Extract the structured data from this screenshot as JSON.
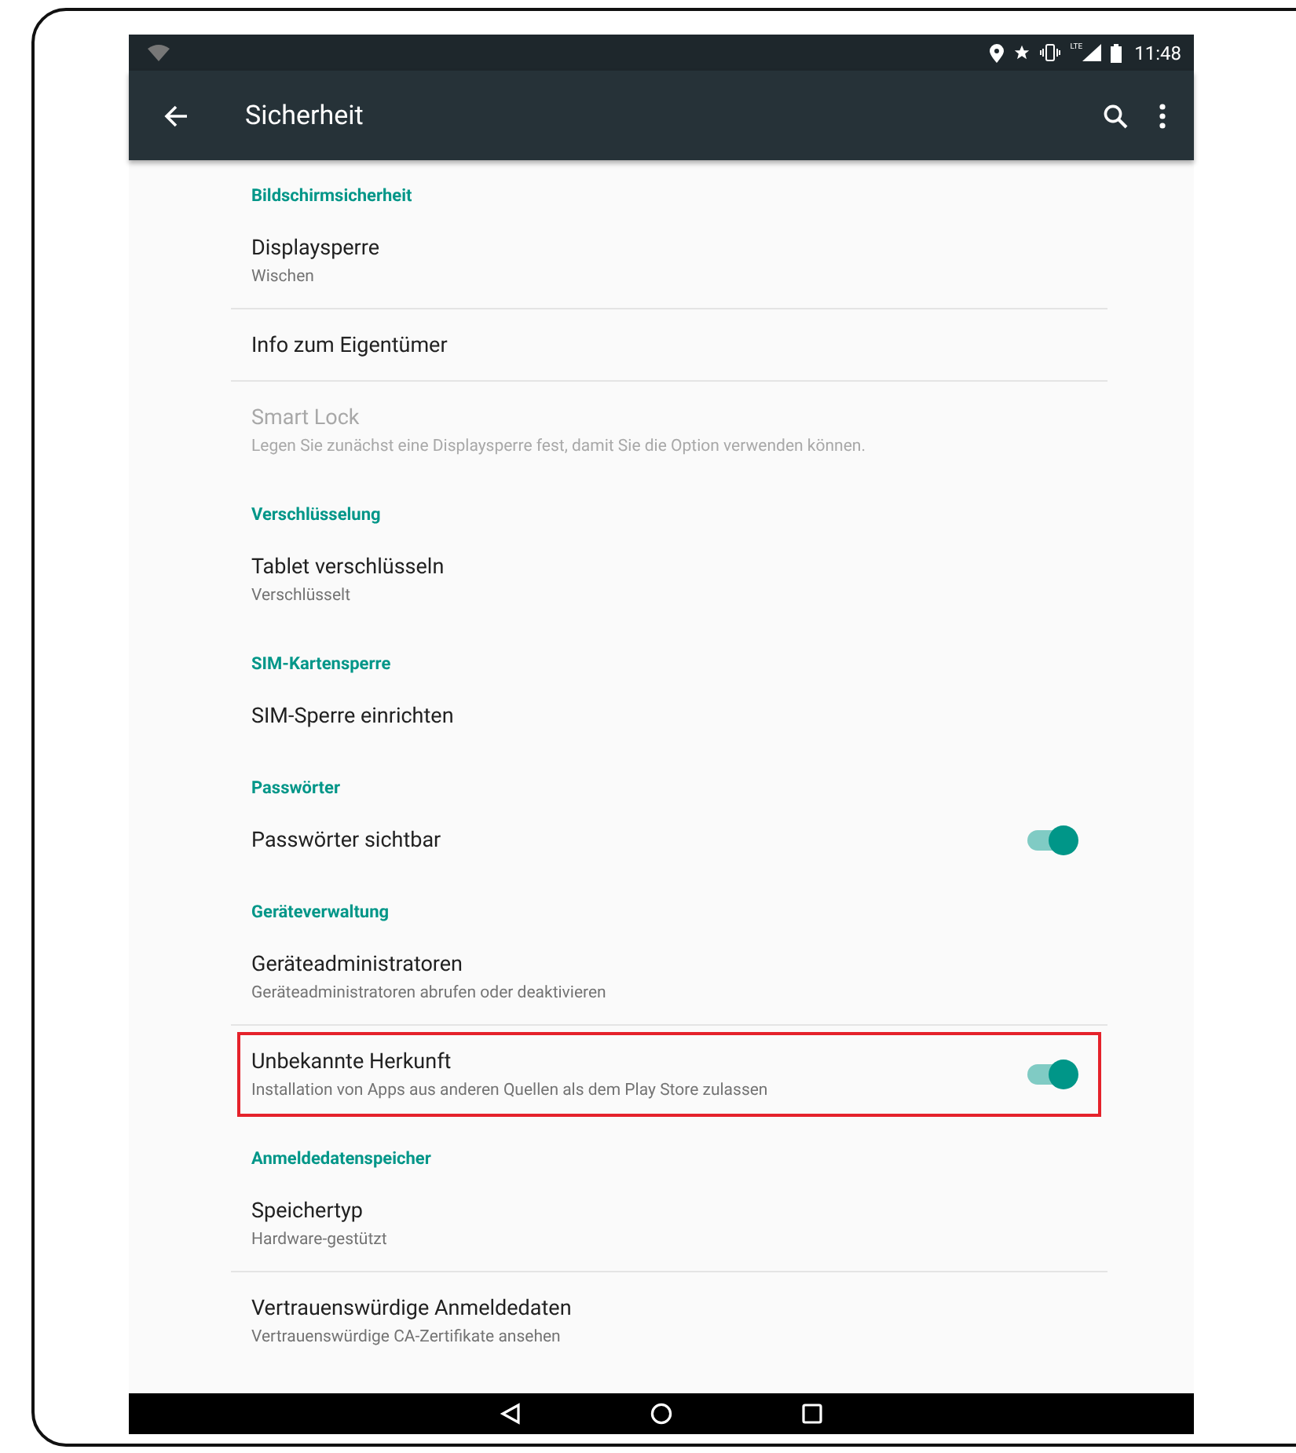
{
  "status_bar": {
    "network": "LTE",
    "time": "11:48"
  },
  "toolbar": {
    "title": "Sicherheit"
  },
  "list": [
    {
      "kind": "header",
      "title": "Bildschirmsicherheit"
    },
    {
      "kind": "item",
      "title": "Displaysperre",
      "summary": "Wischen",
      "disabled": false
    },
    {
      "kind": "item",
      "title": "Info zum Eigentümer",
      "disabled": false
    },
    {
      "kind": "item",
      "title": "Smart Lock",
      "summary": "Legen Sie zunächst eine Displaysperre fest, damit Sie die Option verwenden können.",
      "disabled": true
    },
    {
      "kind": "header",
      "title": "Verschlüsselung"
    },
    {
      "kind": "item",
      "title": "Tablet verschlüsseln",
      "summary": "Verschlüsselt",
      "disabled": false
    },
    {
      "kind": "header",
      "title": "SIM-Kartensperre"
    },
    {
      "kind": "item",
      "title": "SIM-Sperre einrichten",
      "disabled": false
    },
    {
      "kind": "header",
      "title": "Passwörter"
    },
    {
      "kind": "switch",
      "title": "Passwörter sichtbar",
      "on": true,
      "highlighted": false
    },
    {
      "kind": "header",
      "title": "Geräteverwaltung"
    },
    {
      "kind": "item",
      "title": "Geräteadministratoren",
      "summary": "Geräteadministratoren abrufen oder deaktivieren",
      "disabled": false
    },
    {
      "kind": "switch",
      "title": "Unbekannte Herkunft",
      "summary": "Installation von Apps aus anderen Quellen als dem Play Store zulassen",
      "on": true,
      "highlighted": true
    },
    {
      "kind": "header",
      "title": "Anmeldedatenspeicher"
    },
    {
      "kind": "item",
      "title": "Speichertyp",
      "summary": "Hardware-gestützt",
      "disabled": false
    },
    {
      "kind": "item",
      "title": "Vertrauenswürdige Anmeldedaten",
      "summary": "Vertrauenswürdige CA-Zertifikate ansehen",
      "disabled": false
    }
  ]
}
